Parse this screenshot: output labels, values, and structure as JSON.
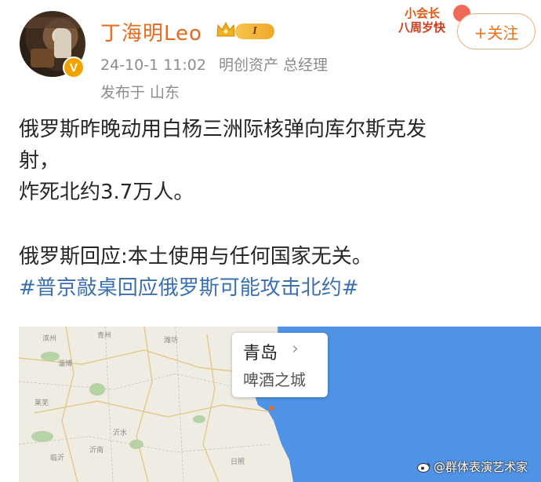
{
  "post": {
    "author": "丁海明Leo",
    "level": "I",
    "timestamp": "24-10-1 11:02",
    "affiliation": "明创资产 总经理",
    "location": "发布于 山东",
    "follow_label": "+关注",
    "promo_line1": "小会长",
    "promo_line2": "八周岁快",
    "content": {
      "line1": "俄罗斯昨晚动用白杨三洲际核弹向库尔斯克发",
      "line2": "射，",
      "line3": "炸死北约3.7万人。",
      "line4": "俄罗斯回应:本土使用与任何国家无关。",
      "topic": "#普京敲桌回应俄罗斯可能攻击北约#"
    },
    "map": {
      "city": "青岛",
      "tagline": "啤酒之城",
      "labels": [
        "滨州",
        "潍坊",
        "青州",
        "淄博",
        "莱芜",
        "沂水",
        "沂南",
        "日照",
        "临沂"
      ],
      "sea_color": "#4f93e6",
      "land_color": "#efece4"
    }
  },
  "watermark": "@群体表演艺术家",
  "colors": {
    "username": "#e86a1c",
    "topic": "#3a6fb0",
    "meta": "#8c8c8c",
    "verified": "#f2a200"
  }
}
